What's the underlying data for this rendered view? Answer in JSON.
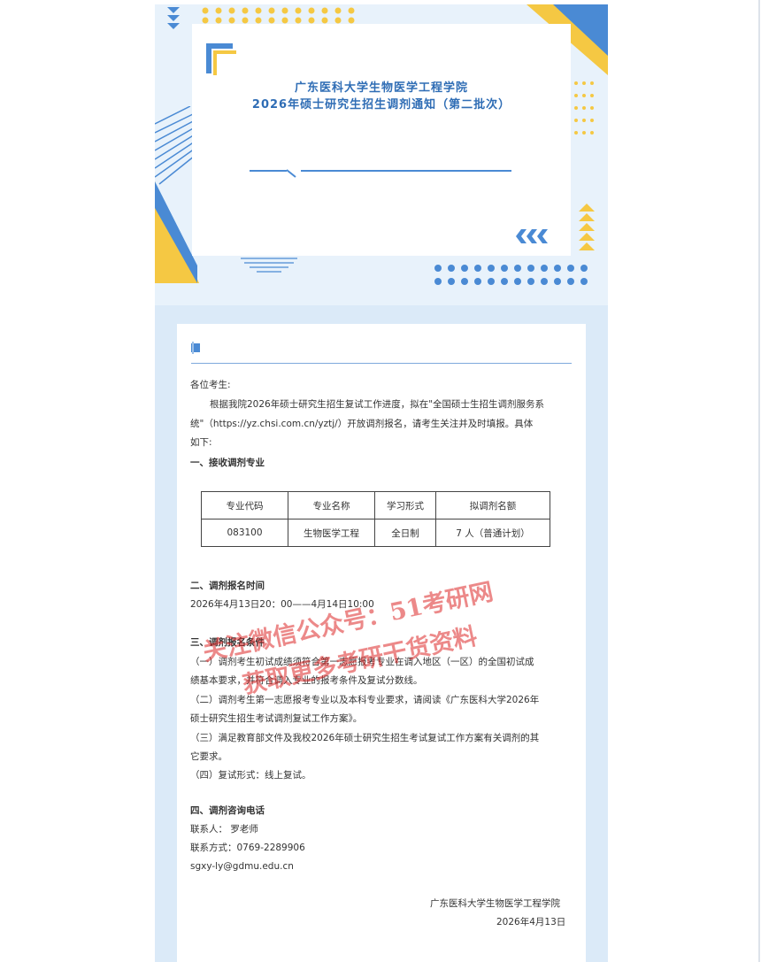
{
  "header": {
    "title_line1": "广东医科大学生物医学工程学院",
    "title_line2": "2026年硕士研究生招生调剂通知（第二批次）",
    "accent_color": "#4a8ad4",
    "yellow_color": "#f5c843"
  },
  "body": {
    "greeting": "各位考生:",
    "intro_line1": "根据我院2026年硕士研究生招生复试工作进度，拟在\"全国硕士生招生调剂服务系",
    "intro_line2": "统\"（https://yz.chsi.com.cn/yztj/）开放调剂报名，请考生关注并及时填报。具体",
    "intro_line3": "如下:",
    "section1": "一、接收调剂专业",
    "table": {
      "headers": [
        "专业代码",
        "专业名称",
        "学习形式",
        "拟调剂名额"
      ],
      "rows": [
        [
          "083100",
          "生物医学工程",
          "全日制",
          "7 人（普通计划）"
        ]
      ]
    },
    "section2": "二、调剂报名时间",
    "time": "2026年4月13日20：00——4月14日10:00",
    "section3": "三、调剂报名条件",
    "c1_line1": "（一）调剂考生初试成绩须符合第一志愿报考专业在调入地区（一区）的全国初试成",
    "c1_line2": "绩基本要求，并符合调入专业的报考条件及复试分数线。",
    "c2_line1": "（二）调剂考生第一志愿报考专业以及本科专业要求，请阅读《广东医科大学2026年",
    "c2_line2": "硕士研究生招生考试调剂复试工作方案》。",
    "c3_line1": "（三）满足教育部文件及我校2026年硕士研究生招生考试复试工作方案有关调剂的其",
    "c3_line2": "它要求。",
    "c4": "（四）复试形式：线上复试。",
    "section4": "四、调剂咨询电话",
    "contact": "联系人：  罗老师",
    "phone": "联系方式：0769-2289906",
    "email": "sgxy-ly@gdmu.edu.cn",
    "sign_org": "广东医科大学生物医学工程学院",
    "sign_date": "2026年4月13日"
  },
  "watermark": {
    "line1": "关注微信公众号：51考研网",
    "line2": "获取更多考研干货资料"
  }
}
